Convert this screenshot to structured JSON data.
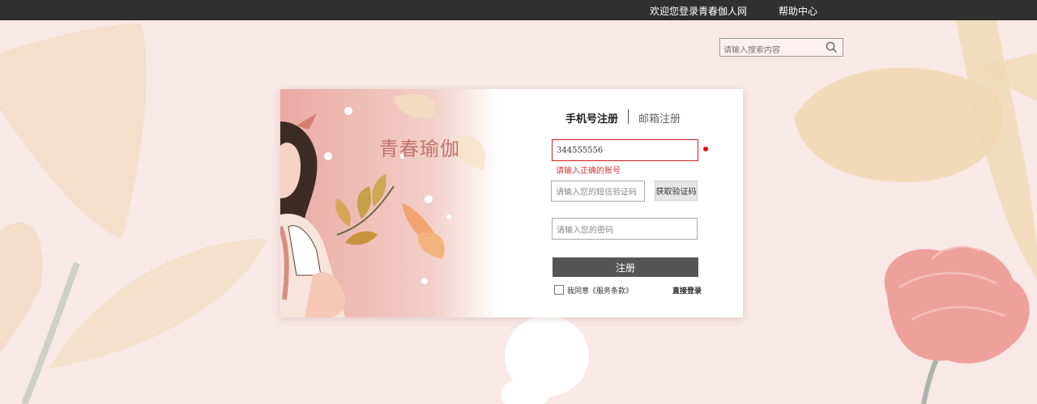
{
  "topbar": {
    "welcome": "欢迎您登录青春伽人网",
    "help": "帮助中心"
  },
  "search": {
    "placeholder": "请输入搜索内容",
    "icon": "search-icon"
  },
  "card": {
    "brand": "青春瑜伽",
    "tabs": [
      {
        "label": "手机号注册",
        "active": true
      },
      {
        "label": "邮箱注册",
        "active": false
      }
    ],
    "account": {
      "value": "344555556",
      "error": "请输入正确的账号"
    },
    "code": {
      "placeholder": "请输入您的短信验证码",
      "button": "获取验证码"
    },
    "password": {
      "placeholder": "请输入您的密码"
    },
    "register_button": "注册",
    "agreement": "我同意《服务条款》",
    "direct_login": "直接登录"
  },
  "colors": {
    "topbar": "#303030",
    "background": "#f8e8e6",
    "error": "#d32020",
    "button": "#555555",
    "brand": "#c0736c"
  }
}
